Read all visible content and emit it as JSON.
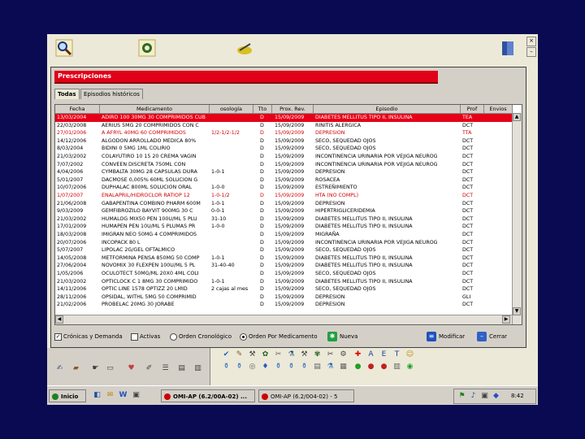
{
  "window": {
    "title": "Prescripciones",
    "close": "×",
    "minimize": "–"
  },
  "tabs": [
    {
      "label": "Todas"
    },
    {
      "label": "Episodios históricos"
    }
  ],
  "table": {
    "columns": [
      "Fecha",
      "Medicamento",
      "osología",
      "Tto",
      "Prox. Rev.",
      "Episodio",
      "Prof",
      "Envios"
    ],
    "rows": [
      {
        "fecha": "13/03/2004",
        "med": "ADIRO 100 30MG 30 COMPRIMIDOS CUB",
        "pos": "",
        "tto": "D",
        "rev": "15/09/2009",
        "epi": "DIABETES MELLITUS TIPO II, INSULINA",
        "prof": "TEA",
        "style": "sel"
      },
      {
        "fecha": "22/03/2008",
        "med": "AERIUS 5MG 20 COMPRIMIDOS CON C",
        "pos": "",
        "tto": "D",
        "rev": "15/09/2009",
        "epi": "RINITIS ALERGICA",
        "prof": "DCT",
        "style": ""
      },
      {
        "fecha": "27/01/2006",
        "med": "A AFRYL 40MG 60 COMPRIMIDOS",
        "pos": "1/2-1/2-1/2",
        "tto": "D",
        "rev": "15/09/2009",
        "epi": "DEPRESION",
        "prof": "TTA",
        "style": "red"
      },
      {
        "fecha": "14/12/2006",
        "med": "ALGODON ARROLLADO MEDICA 80%",
        "pos": "",
        "tto": "D",
        "rev": "15/09/2009",
        "epi": "SECO, SEQUEDAD OJOS",
        "prof": "DCT",
        "style": ""
      },
      {
        "fecha": "8/03/2004",
        "med": "BIDINI 0 5MG 1ML COLIRIO",
        "pos": "",
        "tto": "D",
        "rev": "15/09/2009",
        "epi": "SECO, SEQUEDAD OJOS",
        "prof": "DCT",
        "style": ""
      },
      {
        "fecha": "21/03/2002",
        "med": "COLAYUTIRO 10 15 20 CREMA VAGIN",
        "pos": "",
        "tto": "D",
        "rev": "15/09/2009",
        "epi": "INCONTINENCIA URINARIA POR VEJIGA NEUROG",
        "prof": "DCT",
        "style": ""
      },
      {
        "fecha": "7/07/2002",
        "med": "CONVEEN DISCRETA 750ML CON",
        "pos": "",
        "tto": "D",
        "rev": "15/09/2009",
        "epi": "INCONTINENCIA URINARIA POR VEJIGA NEUROG",
        "prof": "DCT",
        "style": ""
      },
      {
        "fecha": "4/04/2006",
        "med": "CYMBALTA 30MG 28 CAPSULAS DURA",
        "pos": "1-0-1",
        "tto": "D",
        "rev": "15/09/2009",
        "epi": "DEPRESION",
        "prof": "DCT",
        "style": ""
      },
      {
        "fecha": "5/01/2007",
        "med": "DACMOSE 0,005% 60ML SOLUCION G",
        "pos": "",
        "tto": "D",
        "rev": "15/09/2009",
        "epi": "ROSACEA",
        "prof": "DCT",
        "style": ""
      },
      {
        "fecha": "10/07/2006",
        "med": "DUPHALAC 800ML SOLUCION ORAL",
        "pos": "1-0-0",
        "tto": "D",
        "rev": "15/09/2009",
        "epi": "ESTREÑIMIENTO",
        "prof": "DCT",
        "style": ""
      },
      {
        "fecha": "1/07/2007",
        "med": "ENALAPRIL/HIDROCLOR RATIOP 12",
        "pos": "1-0-1/2",
        "tto": "D",
        "rev": "15/09/2009",
        "epi": "HTA (NO COMPL)",
        "prof": "DCT",
        "style": "red"
      },
      {
        "fecha": "21/06/2008",
        "med": "GABAPENTINA COMBINO PHARM 600M",
        "pos": "1-0-1",
        "tto": "D",
        "rev": "15/09/2009",
        "epi": "DEPRESION",
        "prof": "DCT",
        "style": ""
      },
      {
        "fecha": "9/03/2009",
        "med": "GEMFIBROZILO BAYVIT 900MG 30 C",
        "pos": "0-0-1",
        "tto": "D",
        "rev": "15/09/2009",
        "epi": "HIPERTRIGLICERIDEMIA",
        "prof": "DCT",
        "style": ""
      },
      {
        "fecha": "21/03/2002",
        "med": "HUMALOG MIX50 PEN 100U/ML 5 PLU",
        "pos": "31-10",
        "tto": "D",
        "rev": "15/09/2009",
        "epi": "DIABETES MELLITUS TIPO II, INSULINA",
        "prof": "DCT",
        "style": ""
      },
      {
        "fecha": "17/01/2009",
        "med": "HUMAPEN PEN 10U/ML 5 PLUMAS PR",
        "pos": "1-0-0",
        "tto": "D",
        "rev": "15/09/2009",
        "epi": "DIABETES MELLITUS TIPO II, INSULINA",
        "prof": "DCT",
        "style": ""
      },
      {
        "fecha": "18/03/2008",
        "med": "IMIGRAN NEO 50MG 4 COMPRIMIDOS",
        "pos": "",
        "tto": "D",
        "rev": "15/09/2009",
        "epi": "MIGRAÑA",
        "prof": "DCT",
        "style": ""
      },
      {
        "fecha": "20/07/2006",
        "med": "INCOPACK 80 L",
        "pos": "",
        "tto": "D",
        "rev": "15/09/2009",
        "epi": "INCONTINENCIA URINARIA POR VEJIGA NEUROG",
        "prof": "DCT",
        "style": ""
      },
      {
        "fecha": "5/07/2007",
        "med": "LIPOLAC 2G/GEL OFTALMICO",
        "pos": "",
        "tto": "D",
        "rev": "15/09/2009",
        "epi": "SECO, SEQUEDAD OJOS",
        "prof": "DCT",
        "style": ""
      },
      {
        "fecha": "14/05/2008",
        "med": "METFORMINA PENSA 850MG 50 COMP",
        "pos": "1-0-1",
        "tto": "D",
        "rev": "15/09/2009",
        "epi": "DIABETES MELLITUS TIPO II, INSULINA",
        "prof": "DCT",
        "style": ""
      },
      {
        "fecha": "27/06/2004",
        "med": "NOVOMIX 30 FLEXPEN 100U/ML 5 PL",
        "pos": "31-40-40",
        "tto": "D",
        "rev": "15/09/2009",
        "epi": "DIABETES MELLITUS TIPO II, INSULINA",
        "prof": "DCT",
        "style": ""
      },
      {
        "fecha": "1/05/2006",
        "med": "OCULOTECT 50MG/ML 20X0 4ML COLI",
        "pos": "",
        "tto": "D",
        "rev": "15/09/2009",
        "epi": "SECO, SEQUEDAD OJOS",
        "prof": "DCT",
        "style": ""
      },
      {
        "fecha": "21/03/2002",
        "med": "OPTICLOCK C 1 8MG 30 COMPRIMIDO",
        "pos": "1-0-1",
        "tto": "D",
        "rev": "15/09/2009",
        "epi": "DIABETES MELLITUS TIPO II, INSULINA",
        "prof": "DCT",
        "style": ""
      },
      {
        "fecha": "14/11/2006",
        "med": "OPTIC LINE 1578 OPTIZZ 20 LMID",
        "pos": "2 cajas al mes",
        "tto": "D",
        "rev": "15/09/2009",
        "epi": "SECO, SEQUEDAD OJOS",
        "prof": "DCT",
        "style": ""
      },
      {
        "fecha": "28/11/2006",
        "med": "OPSIDAL, WITHL 5MG 50 COMPRIMID",
        "pos": "",
        "tto": "D",
        "rev": "15/09/2009",
        "epi": "DEPRESION",
        "prof": "GLI",
        "style": ""
      },
      {
        "fecha": "21/02/2006",
        "med": "PROBELAC 20MG 30 JORABE",
        "pos": "",
        "tto": "D",
        "rev": "15/09/2009",
        "epi": "DEPRESION",
        "prof": "DCT",
        "style": ""
      }
    ]
  },
  "bottom": {
    "chk_cronicas": "Crónicas y Demanda",
    "chk_activas": "Activas",
    "radio_crono": "Orden Cronológico",
    "radio_medic": "Orden Por Medicamento",
    "btn_nueva": "Nueva",
    "btn_modificar": "Modificar",
    "btn_cerrar": "Cerrar"
  },
  "taskbar": {
    "start": "Inicio",
    "task1": "OMI-AP (6.2/00A-02) ...",
    "task2": "OMI-AP (6.2/004-02) - 5",
    "clock": "8:42"
  },
  "colors": {
    "background": "#0a0a52",
    "selection": "#e60018",
    "title_red": "#e00018"
  }
}
